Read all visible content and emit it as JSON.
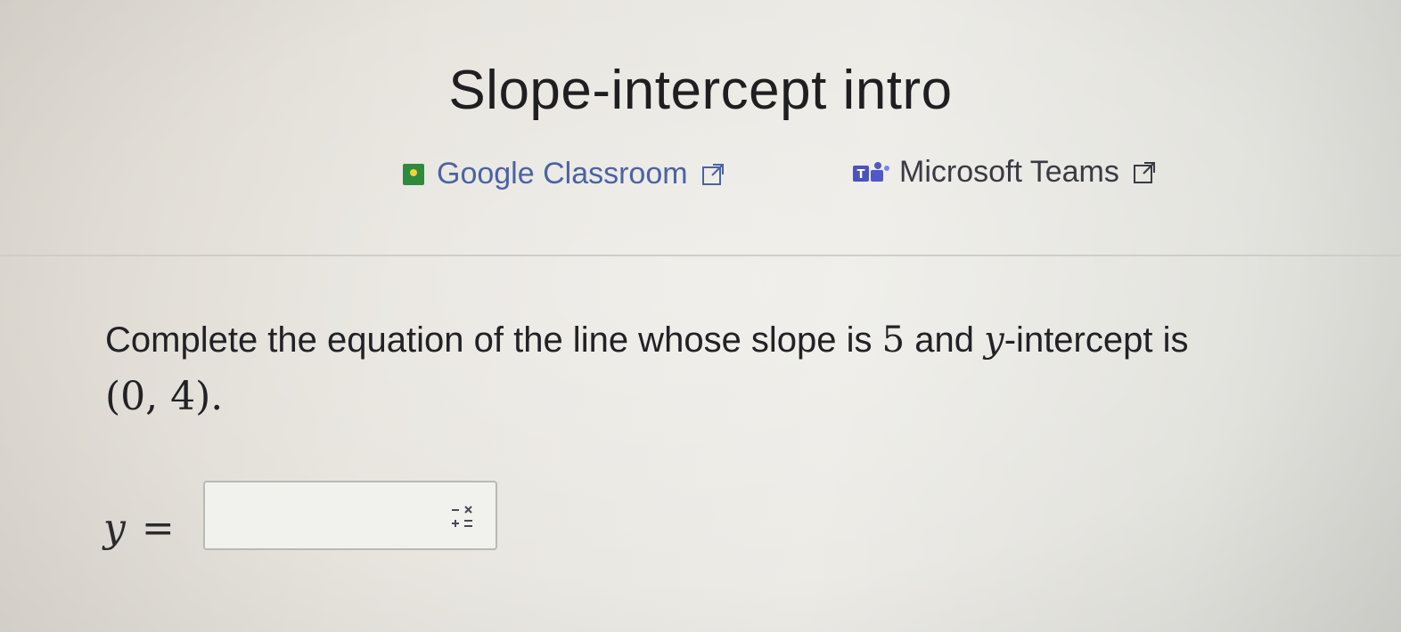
{
  "page": {
    "title": "Slope-intercept intro"
  },
  "share": {
    "google_classroom": {
      "label": "Google Classroom",
      "icon": "google-classroom-icon",
      "color": "#4a63a4"
    },
    "microsoft_teams": {
      "label": "Microsoft Teams",
      "icon": "microsoft-teams-icon",
      "color": "#3a3a42"
    }
  },
  "question": {
    "prefix": "Complete the equation of the line whose slope is",
    "slope": "5",
    "middle": "and",
    "y_var": "y",
    "suffix": "-intercept is",
    "point": "(0, 4)",
    "period": "."
  },
  "answer": {
    "lhs_var": "y",
    "equals": "=",
    "value": "",
    "keypad_icon": "math-keypad-icon"
  }
}
